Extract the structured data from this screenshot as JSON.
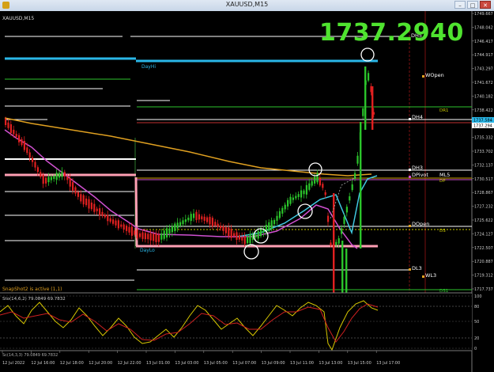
{
  "window": {
    "title": "XAUUSD,M15",
    "minimize": "–",
    "maximize": "□",
    "close": "✕"
  },
  "chart_title": "XAUUSD,M15",
  "big_price": "1737.2940",
  "price_axis": [
    "1749.667",
    "1748.042",
    "1746.417",
    "1744.917",
    "1743.297",
    "1741.672",
    "1740.182",
    "1738.422",
    "1736.797",
    "1735.332",
    "1733.702",
    "1732.137",
    "1730.517",
    "1728.867",
    "1727.232",
    "1725.622",
    "1724.127",
    "1722.507",
    "1720.887",
    "1719.312",
    "1717.737"
  ],
  "price_tags": [
    {
      "text": "1737.584",
      "color": "#2ab7e8"
    },
    {
      "text": "1737.294",
      "color": "#ffffff"
    }
  ],
  "levels": [
    {
      "label": "DH5",
      "color": "#ffffff"
    },
    {
      "label": "DayHi",
      "color": "#2ab7e8"
    },
    {
      "label": "WOpen",
      "color": "#ffffff"
    },
    {
      "label": "DR1",
      "color": "#c8c800"
    },
    {
      "label": "DH4",
      "color": "#ffffff"
    },
    {
      "label": "DH3",
      "color": "#ffffff"
    },
    {
      "label": "DPivot",
      "color": "#ffffff"
    },
    {
      "label": "ML5",
      "color": "#ffffff"
    },
    {
      "label": "DP",
      "color": "#c8c800"
    },
    {
      "label": "DOpen",
      "color": "#ffffff"
    },
    {
      "label": "DS",
      "color": "#c8c800"
    },
    {
      "label": "DayLo",
      "color": "#2ab7e8"
    },
    {
      "label": "DL3",
      "color": "#ffffff"
    },
    {
      "label": "WL3",
      "color": "#ffffff"
    },
    {
      "label": "DS1",
      "color": "#2bc42b"
    }
  ],
  "indicator_status": "SnapShot2 is active (1,1)",
  "stoch_label": "Sto(14,6,2) 79.0849 69.7832",
  "stoch_levels": [
    "100",
    "80",
    "50",
    "20",
    "0"
  ],
  "bottom_label": "Sc(14,3,3) 79.0849 69.7832",
  "time_axis": [
    "12 Jul 2022",
    "12 Jul 16:00",
    "12 Jul 18:00",
    "12 Jul 20:00",
    "12 Jul 22:00",
    "13 Jul 01:00",
    "13 Jul 03:00",
    "13 Jul 05:00",
    "13 Jul 07:00",
    "13 Jul 09:00",
    "13 Jul 11:00",
    "13 Jul 13:00",
    "13 Jul 15:00",
    "13 Jul 17:00"
  ],
  "colors": {
    "bull": "#2bc42b",
    "bear": "#e02020",
    "ma_orange": "#e0a020",
    "ma_cyan": "#40c8e0",
    "ma_magenta": "#d050d0",
    "highlight": "#4fe32f",
    "stoch_yellow": "#d8c800",
    "stoch_red": "#d02020"
  }
}
